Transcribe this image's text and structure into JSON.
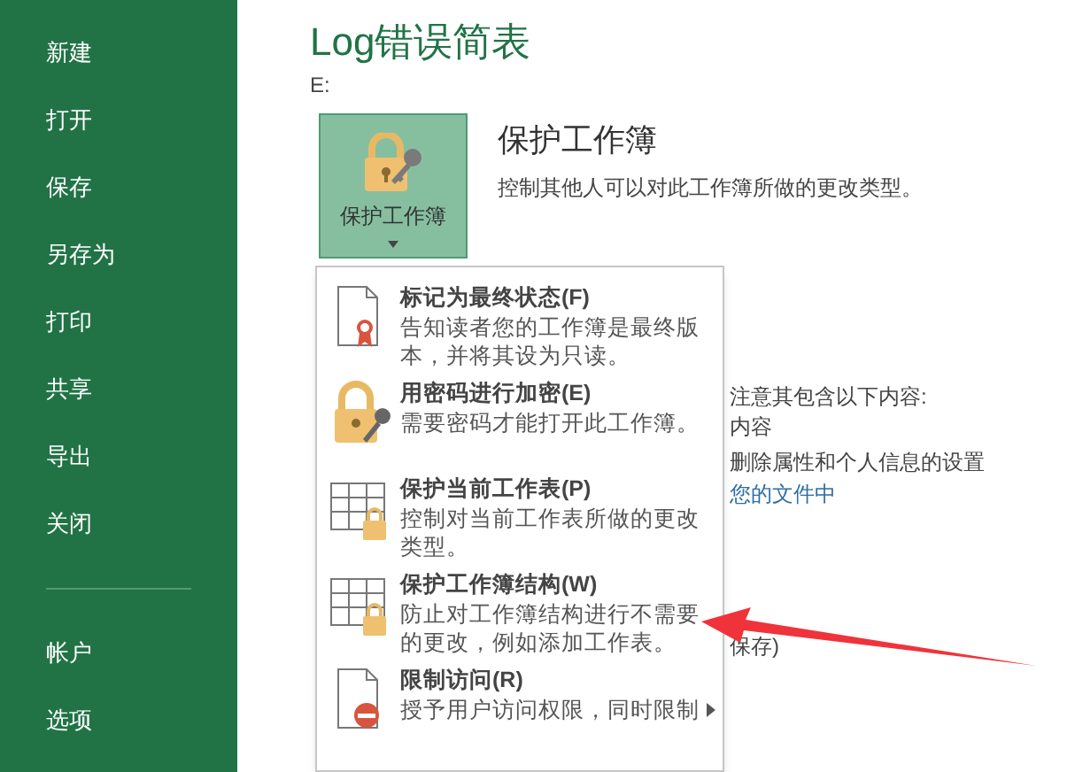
{
  "sidebar": {
    "items": [
      {
        "label": "新建"
      },
      {
        "label": "打开"
      },
      {
        "label": "保存"
      },
      {
        "label": "另存为"
      },
      {
        "label": "打印"
      },
      {
        "label": "共享"
      },
      {
        "label": "导出"
      },
      {
        "label": "关闭"
      }
    ],
    "bottom_items": [
      {
        "label": "帐户"
      },
      {
        "label": "选项"
      }
    ]
  },
  "document": {
    "title": "Log错误简表",
    "path": "E:"
  },
  "protect": {
    "button_label": "保护工作簿",
    "heading": "保护工作簿",
    "description": "控制其他人可以对此工作簿所做的更改类型。"
  },
  "background_text": [
    {
      "kind": "text",
      "text": "注意其包含以下内容:"
    },
    {
      "kind": "text",
      "text": "内容"
    },
    {
      "kind": "text",
      "text": "删除属性和个人信息的设置"
    },
    {
      "kind": "link",
      "text": "您的文件中"
    },
    {
      "kind": "text",
      "text": "保存)"
    }
  ],
  "menu": [
    {
      "kind": "final",
      "title": "标记为最终状态(F)",
      "description": "告知读者您的工作簿是最终版本，并将其设为只读。",
      "has_submenu": false
    },
    {
      "kind": "encrypt",
      "title": "用密码进行加密(E)",
      "description": "需要密码才能打开此工作簿。",
      "has_submenu": false
    },
    {
      "kind": "sheet",
      "title": "保护当前工作表(P)",
      "description": "控制对当前工作表所做的更改类型。",
      "has_submenu": false
    },
    {
      "kind": "sheet",
      "title": "保护工作簿结构(W)",
      "description": "防止对工作簿结构进行不需要的更改，例如添加工作表。",
      "has_submenu": false
    },
    {
      "kind": "restrict",
      "title": "限制访问(R)",
      "description": "授予用户访问权限，同时限制",
      "has_submenu": true
    }
  ]
}
